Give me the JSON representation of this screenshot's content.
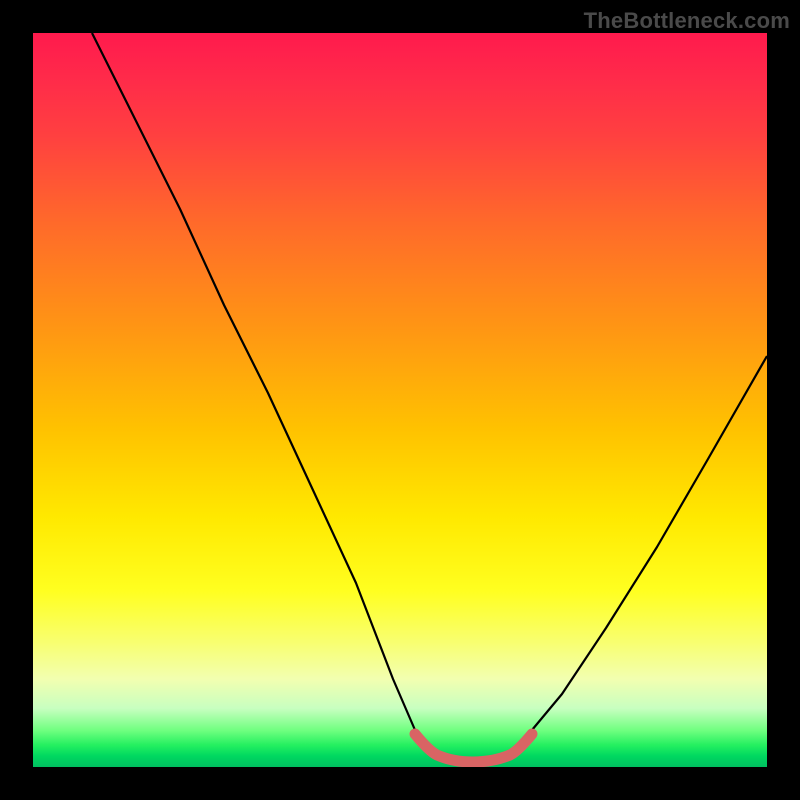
{
  "watermark": "TheBottleneck.com",
  "chart_data": {
    "type": "line",
    "title": "",
    "xlabel": "",
    "ylabel": "",
    "xlim": [
      0,
      100
    ],
    "ylim": [
      0,
      100
    ],
    "grid": false,
    "series": [
      {
        "name": "black-curve",
        "x": [
          8,
          14,
          20,
          26,
          32,
          38,
          44,
          49,
          52,
          55,
          58,
          62,
          65,
          68,
          72,
          78,
          85,
          92,
          100
        ],
        "values": [
          100,
          88,
          76,
          63,
          51,
          38,
          25,
          12,
          5,
          2,
          1,
          1,
          2,
          5,
          10,
          19,
          30,
          42,
          56
        ]
      },
      {
        "name": "red-flat-segment",
        "x": [
          52,
          54,
          56,
          58,
          60,
          62,
          64,
          66
        ],
        "values": [
          4.5,
          2.2,
          1.2,
          1.0,
          1.0,
          1.2,
          2.2,
          4.5
        ]
      }
    ],
    "colors": {
      "black_curve": "#000000",
      "red_segment": "#d96464",
      "gradient_top": "#ff1a4d",
      "gradient_mid": "#ffe900",
      "gradient_bottom": "#00c060",
      "frame": "#000000"
    }
  }
}
